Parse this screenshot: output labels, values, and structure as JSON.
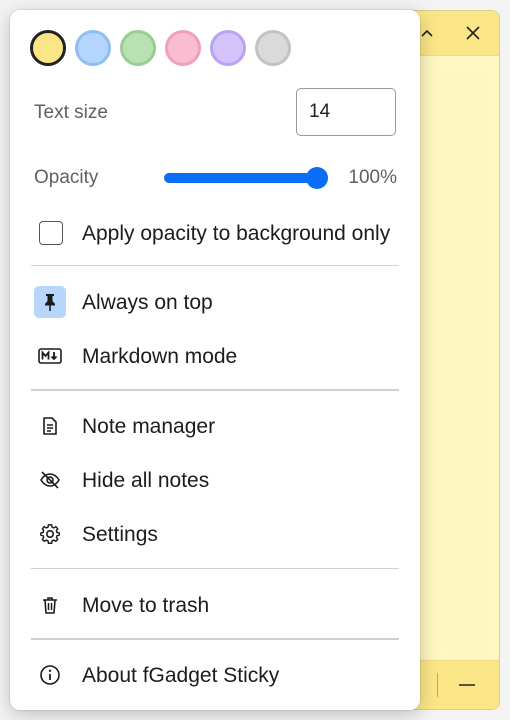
{
  "theme": {
    "accent": "#0a6cf7",
    "note_background": "#fff6c0",
    "note_titlebar": "#fbe687"
  },
  "color_swatches": [
    {
      "name": "yellow",
      "color": "#fbe687",
      "border": "#222222",
      "selected": true
    },
    {
      "name": "blue",
      "color": "#b4d5fc",
      "border": "#8fbef5",
      "selected": false
    },
    {
      "name": "green",
      "color": "#b8e2b4",
      "border": "#97cf92",
      "selected": false
    },
    {
      "name": "pink",
      "color": "#f9bcd0",
      "border": "#f0a1b9",
      "selected": false
    },
    {
      "name": "purple",
      "color": "#d4c2fb",
      "border": "#b9a3f3",
      "selected": false
    },
    {
      "name": "gray",
      "color": "#dadada",
      "border": "#c2c2c2",
      "selected": false
    }
  ],
  "text_size": {
    "label": "Text size",
    "value": "14"
  },
  "opacity": {
    "label": "Opacity",
    "value_text": "100%",
    "fraction": 1.0
  },
  "apply_opacity": {
    "label": "Apply opacity to background only",
    "checked": false
  },
  "menu_items": {
    "always_on_top": {
      "label": "Always on top",
      "icon": "pin-icon",
      "active": true
    },
    "markdown_mode": {
      "label": "Markdown mode",
      "icon": "markdown-icon"
    },
    "note_manager": {
      "label": "Note manager",
      "icon": "document-icon"
    },
    "hide_all_notes": {
      "label": "Hide all notes",
      "icon": "eye-off-icon"
    },
    "settings": {
      "label": "Settings",
      "icon": "gear-icon"
    },
    "move_to_trash": {
      "label": "Move to trash",
      "icon": "trash-icon"
    },
    "about": {
      "label": "About fGadget Sticky",
      "icon": "info-icon"
    }
  },
  "note_window": {
    "collapse_icon": "chevron-up-icon",
    "close_icon": "close-icon",
    "minimize_icon": "minus-icon"
  }
}
